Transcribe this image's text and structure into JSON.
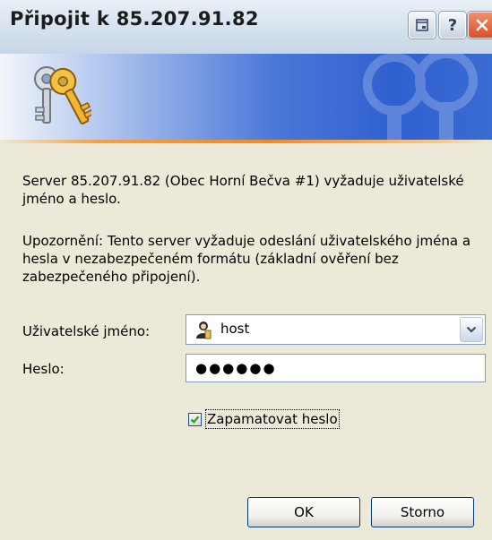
{
  "window": {
    "title": "Připojit k 85.207.91.82"
  },
  "title_buttons": {
    "minimize_icon": "restore-icon",
    "help_label": "?",
    "close_icon": "close-icon"
  },
  "banner": {
    "icon": "keys-icon",
    "accent_color": "#f28a22"
  },
  "message": {
    "line1": "Server 85.207.91.82 (Obec Horní Bečva #1) vyžaduje uživatelské jméno a heslo.",
    "line2": "Upozornění: Tento server vyžaduje odeslání uživatelského jména a hesla v nezabezpečeném formátu (základní ověření bez zabezpečeného připojení)."
  },
  "form": {
    "username_label": "Uživatelské jméno:",
    "username_value": "host",
    "username_icon": "user-icon",
    "password_label": "Heslo:",
    "password_value": "●●●●●●",
    "remember_label": "Zapamatovat heslo",
    "remember_checked": true
  },
  "buttons": {
    "ok": "OK",
    "cancel": "Storno"
  },
  "colors": {
    "dialog_bg": "#ECE9D8",
    "banner_blue": "#2f60cf",
    "close_red": "#d94f2b"
  }
}
